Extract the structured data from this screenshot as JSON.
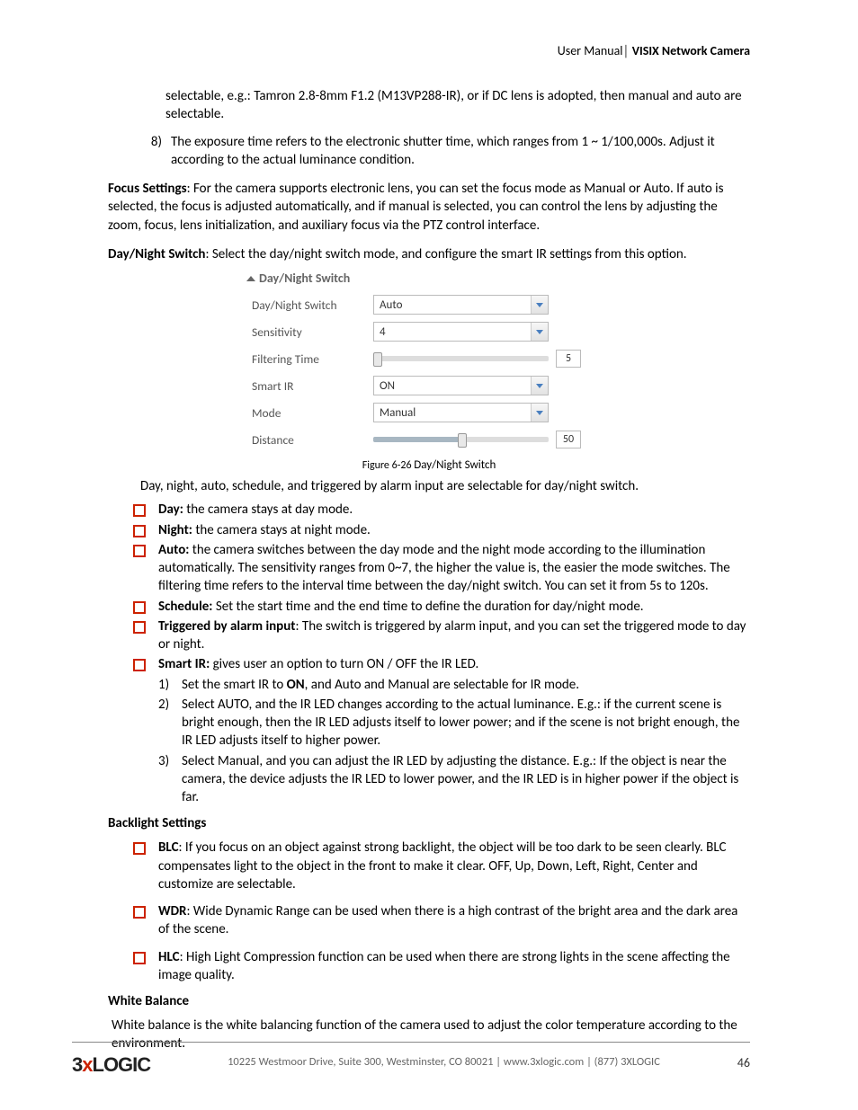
{
  "header": {
    "left": "User Manual│ ",
    "bold": "VISIX Network Camera"
  },
  "intro_continued": "selectable, e.g.: Tamron 2.8-8mm F1.2 (M13VP288-IR), or if DC lens is adopted, then manual and auto are selectable.",
  "item8": {
    "num": "8)",
    "text": "The exposure time refers to the electronic shutter time, which ranges from 1 ~ 1/100,000s. Adjust it according to the actual luminance condition."
  },
  "focus": {
    "label": "Focus Settings",
    "text": ": For the camera supports electronic lens, you can set the focus mode as Manual or Auto. If auto is selected, the focus is adjusted automatically, and if manual is selected, you can control the lens by adjusting the zoom, focus, lens initialization, and auxiliary focus via the PTZ control interface."
  },
  "daynight_intro": {
    "label": "Day/Night Switch",
    "text": ": Select the day/night switch mode, and configure the smart IR settings from this option."
  },
  "panel": {
    "title": "Day/Night Switch",
    "rows": {
      "dn_label": "Day/Night Switch",
      "dn_value": "Auto",
      "sens_label": "Sensitivity",
      "sens_value": "4",
      "filt_label": "Filtering Time",
      "filt_value": "5",
      "filt_pct": 2,
      "ir_label": "Smart IR",
      "ir_value": "ON",
      "mode_label": "Mode",
      "mode_value": "Manual",
      "dist_label": "Distance",
      "dist_value": "50",
      "dist_pct": 50
    }
  },
  "caption": {
    "fig": "Figure 6-26 ",
    "title": "Day/Night Switch"
  },
  "after_caption": "Day, night, auto, schedule, and triggered by alarm input are selectable for day/night switch.",
  "bullets": {
    "day": {
      "b": "Day: ",
      "t": "the camera stays at day mode."
    },
    "night": {
      "b": "Night: ",
      "t": "the camera stays at night mode."
    },
    "auto": {
      "b": "Auto: ",
      "t": "the camera switches between the day mode and the night mode according to the illumination automatically. The sensitivity ranges from 0~7, the higher the value is, the easier the mode switches. The filtering time refers to the interval time between the day/night switch. You can set it from 5s to 120s."
    },
    "schedule": {
      "b": "Schedule: ",
      "t": "Set the start time and the end time to define the duration for day/night mode."
    },
    "triggered": {
      "b": "Triggered by alarm input",
      "t": ": The switch is triggered by alarm input, and you can set the triggered mode to day or night."
    },
    "smartir": {
      "b": "Smart IR: ",
      "t": "gives user an option to turn ON / OFF the IR LED."
    }
  },
  "smartir_sub": {
    "s1": {
      "n": "1)",
      "pre": "Set the smart IR to ",
      "b": "ON",
      "post": ", and Auto and Manual are selectable for IR mode."
    },
    "s2": {
      "n": "2)",
      "t": "Select AUTO, and the IR LED changes according to the actual luminance. E.g.: if the current scene is bright enough, then the IR LED adjusts itself to lower power; and if the scene is not bright enough, the IR LED adjusts itself to higher power."
    },
    "s3": {
      "n": "3)",
      "t": "Select Manual, and you can adjust the IR LED by adjusting the distance. E.g.: If the object is near the camera, the device adjusts the IR LED to lower power, and the IR LED is in higher power if the object is far."
    }
  },
  "backlight_head": "Backlight Settings",
  "backlight": {
    "blc": {
      "b": "BLC",
      "t": ": If you focus on an object against strong backlight, the object will be too dark to be seen clearly. BLC compensates light to the object in the front to make it clear. OFF, Up, Down, Left, Right, Center and customize are selectable."
    },
    "wdr": {
      "b": "WDR",
      "t": ": Wide Dynamic Range can be used when there is a high contrast of the bright area and the dark area of the scene."
    },
    "hlc": {
      "b": "HLC",
      "t": ": High Light Compression function can be used when there are strong lights in the scene affecting the image quality."
    }
  },
  "wb_head": "White Balance",
  "wb_text": "White balance is the white balancing function of the camera used to adjust the color temperature according to the environment.",
  "footer": {
    "logo_pre": "3",
    "logo_x": "x",
    "logo_post": "LOGIC",
    "text": "10225 Westmoor Drive, Suite 300, Westminster, CO 80021 | www.3xlogic.com | (877) 3XLOGIC",
    "page": "46"
  }
}
